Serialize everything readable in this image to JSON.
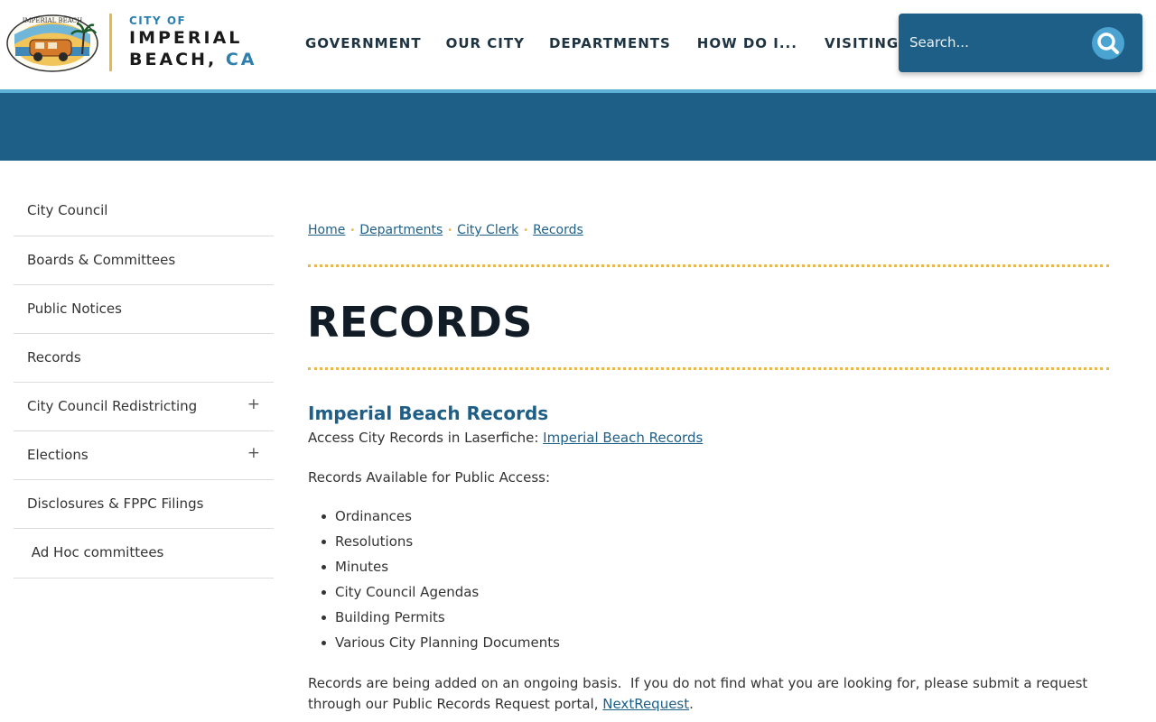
{
  "header": {
    "logo": {
      "seal_text": "IMPERIAL BEACH",
      "city_of": "CITY OF",
      "line1": "IMPERIAL",
      "line2": "BEACH,",
      "state": "CA"
    },
    "nav": [
      "GOVERNMENT",
      "OUR CITY",
      "DEPARTMENTS",
      "HOW DO I...",
      "VISITING"
    ],
    "search": {
      "placeholder": "Search...",
      "icon": "search-icon"
    }
  },
  "colors": {
    "primary": "#1e5f87",
    "accent": "#e6b84f",
    "stripe": "#5fb0d6",
    "title": "#111c27"
  },
  "sidebar": {
    "items": [
      {
        "label": "City Council",
        "expandable": ""
      },
      {
        "label": "Boards & Committees",
        "expandable": ""
      },
      {
        "label": "Public Notices",
        "expandable": ""
      },
      {
        "label": "Records",
        "expandable": ""
      },
      {
        "label": "City Council Redistricting",
        "expandable": "+"
      },
      {
        "label": "Elections",
        "expandable": "+"
      },
      {
        "label": "Disclosures & FPPC Filings",
        "expandable": ""
      },
      {
        "label": " Ad Hoc committees",
        "expandable": ""
      }
    ]
  },
  "breadcrumb": [
    "Home",
    "Departments",
    "City Clerk",
    "Records"
  ],
  "breadcrumb_separator": "•",
  "main": {
    "title": "RECORDS",
    "section_heading": "Imperial Beach Records",
    "access_text": "Access City Records in Laserfiche: ",
    "access_link": "Imperial Beach Records",
    "available_text": "Records Available for Public Access:",
    "records_list": [
      "Ordinances",
      "Resolutions",
      "Minutes",
      "City Council Agendas",
      "Building Permits",
      "Various City Planning Documents"
    ],
    "footer_line1": "Records are being added on an ongoing basis.  If you do not find what you are looking for, please submit a request",
    "footer_line2_prefix": "through our Public Records Request portal, ",
    "footer_link": "NextRequest",
    "footer_suffix": "."
  }
}
